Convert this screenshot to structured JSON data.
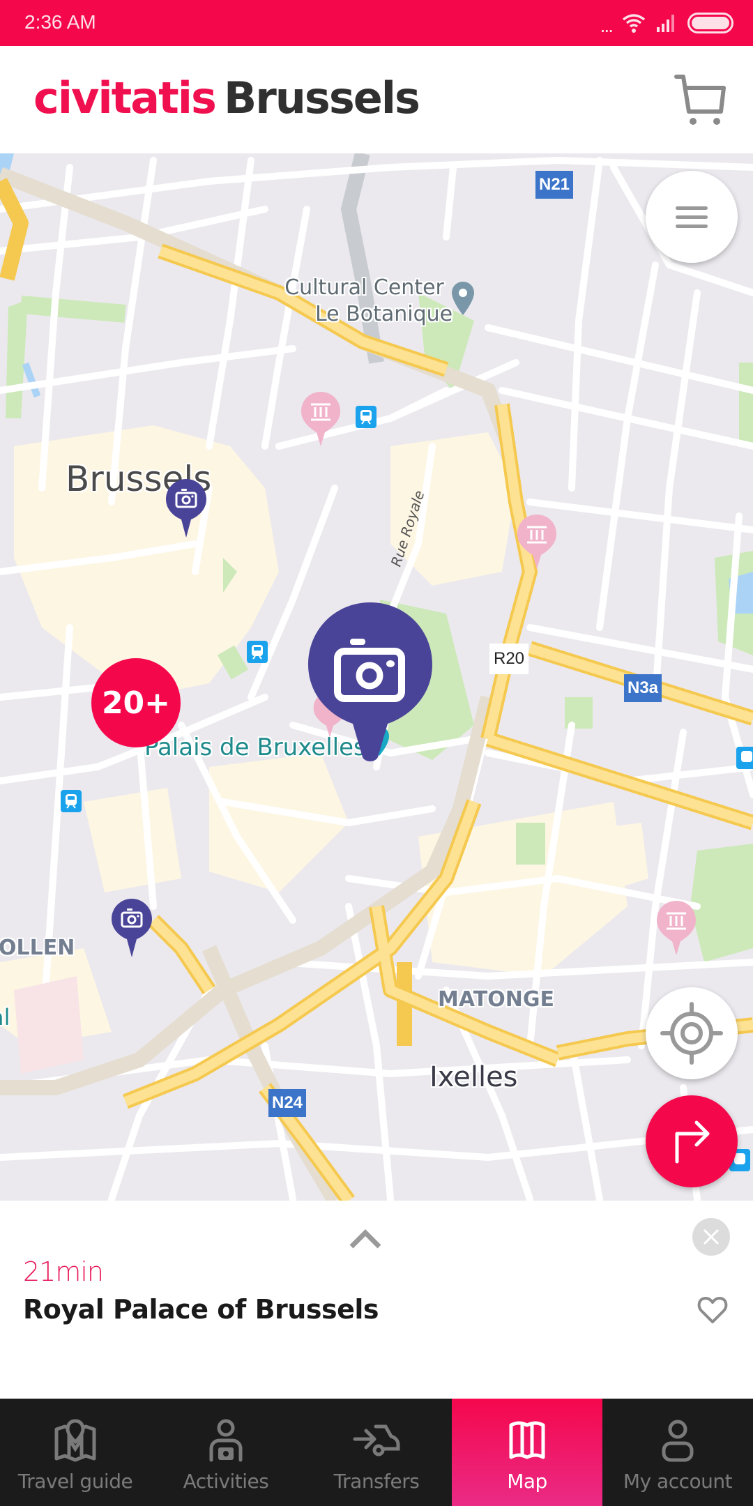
{
  "status_bar": {
    "time": "2:36 AM",
    "dots": "..."
  },
  "header": {
    "brand": "civitatis",
    "city": "Brussels",
    "cart_icon": "cart-icon"
  },
  "colors": {
    "brand_pink": "#f5074c",
    "marker_purple": "#4a4498",
    "nav_bg": "#1c1b1c",
    "museum_pink": "#f0b3ca",
    "road_badge_blue": "#3b74c8"
  },
  "map": {
    "labels": {
      "cultural_center_line1": "Cultural Center",
      "cultural_center_line2": "Le Botanique",
      "brussels": "Brussels",
      "rue_royale": "Rue Royale",
      "palais": "Palais de Bruxelles",
      "marolles_partial": "OLLEN",
      "matonge": "MATONGE",
      "ixelles": "Ixelles",
      "left_edge_partial": "al"
    },
    "road_badges": {
      "n21": "N21",
      "n3a": "N3a",
      "n24": "N24",
      "r20": "R20"
    },
    "cluster_count": "20+",
    "menu_button_icon": "menu-icon",
    "locate_button_icon": "crosshair-icon",
    "directions_button_icon": "turn-right-icon"
  },
  "sheet": {
    "duration": "21min",
    "title": "Royal Palace of Brussels"
  },
  "nav": {
    "items": [
      {
        "label": "Travel guide",
        "icon": "travel-guide-icon",
        "active": false
      },
      {
        "label": "Activities",
        "icon": "activities-icon",
        "active": false
      },
      {
        "label": "Transfers",
        "icon": "transfers-icon",
        "active": false
      },
      {
        "label": "Map",
        "icon": "map-icon",
        "active": true
      },
      {
        "label": "My account",
        "icon": "account-icon",
        "active": false
      }
    ]
  }
}
